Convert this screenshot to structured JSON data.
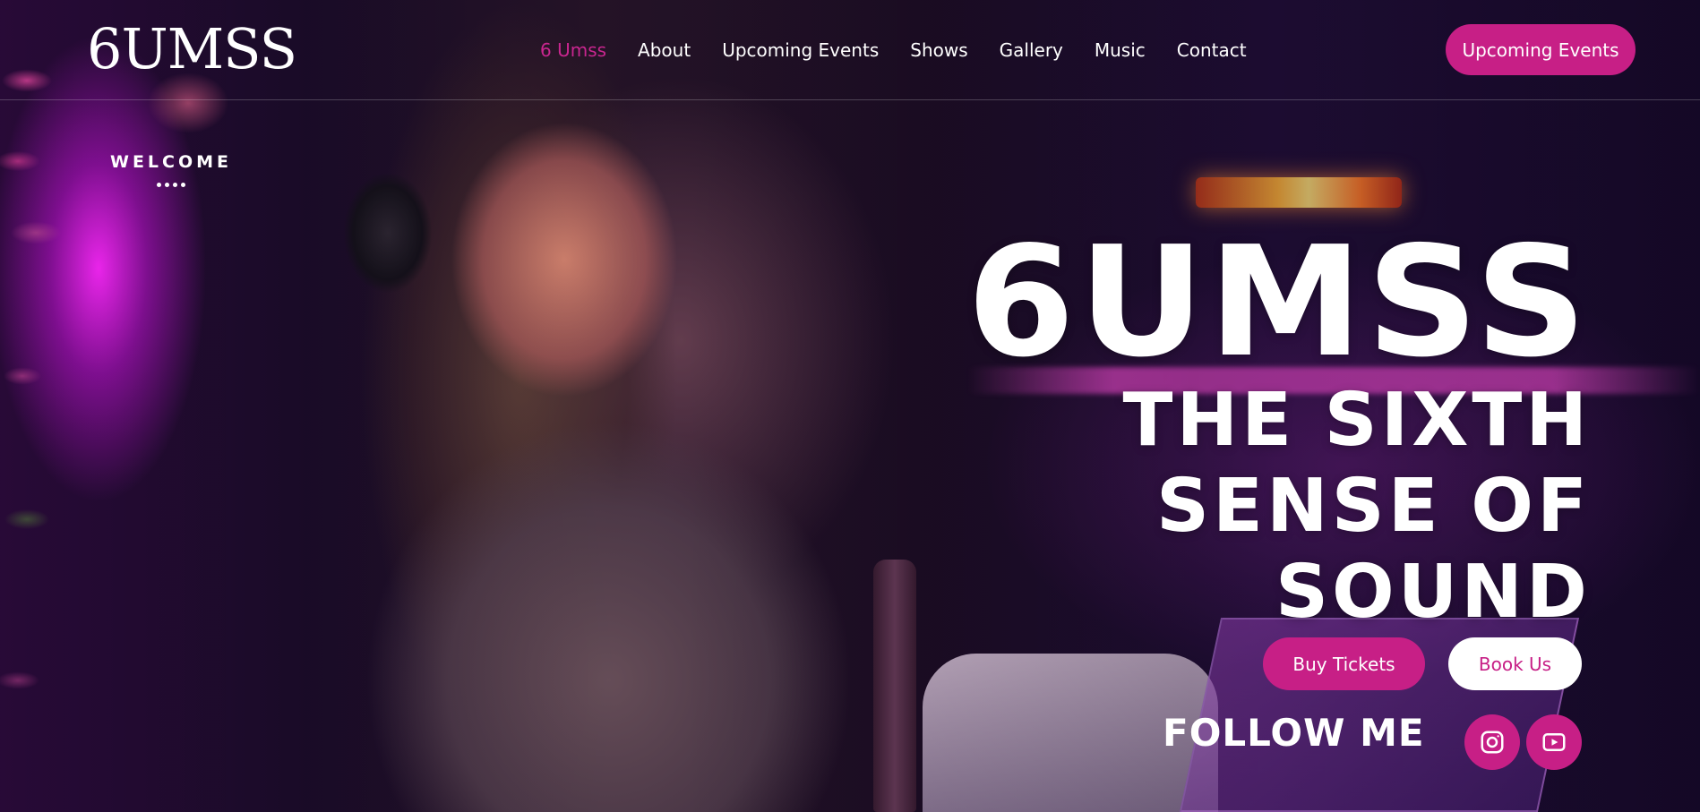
{
  "header": {
    "logo": "6UMSS",
    "nav": [
      {
        "label": "6 Umss",
        "active": true
      },
      {
        "label": "About",
        "active": false
      },
      {
        "label": "Upcoming Events",
        "active": false
      },
      {
        "label": "Shows",
        "active": false
      },
      {
        "label": "Gallery",
        "active": false
      },
      {
        "label": "Music",
        "active": false
      },
      {
        "label": "Contact",
        "active": false
      }
    ],
    "cta_label": "Upcoming Events"
  },
  "welcome": {
    "label": "WELCOME"
  },
  "hero": {
    "name": "6UMSS",
    "tagline_lines": [
      "THE SIXTH",
      "SENSE OF",
      "SOUND"
    ],
    "buy_tickets_label": "Buy Tickets",
    "book_us_label": "Book Us"
  },
  "follow": {
    "label": "FOLLOW ME",
    "icons": [
      "instagram-icon",
      "youtube-icon"
    ]
  },
  "colors": {
    "accent": "#c71f86",
    "text": "#ffffff"
  }
}
